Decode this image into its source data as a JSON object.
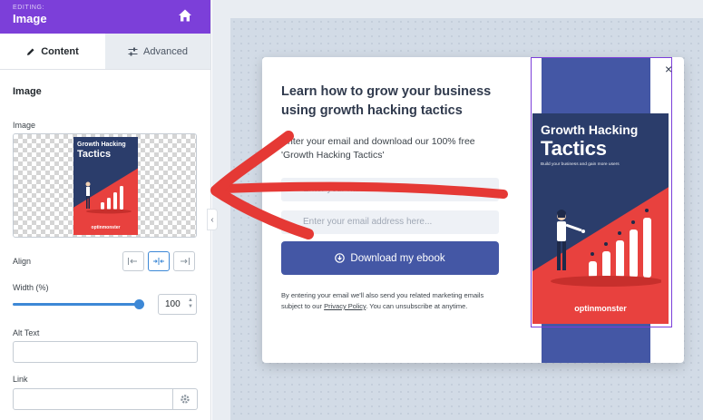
{
  "sidebar": {
    "editing_label": "EDITING:",
    "title": "Image",
    "tabs": [
      {
        "label": "Content",
        "active": true
      },
      {
        "label": "Advanced",
        "active": false
      }
    ],
    "section_title": "Image",
    "image_label": "Image",
    "preview": {
      "title_line1": "Growth Hacking",
      "title_line2": "Tactics",
      "brand": "optinmonster"
    },
    "align_label": "Align",
    "align_options": [
      "left",
      "center",
      "right"
    ],
    "align_selected": "center",
    "width_label": "Width (%)",
    "width_value": "100",
    "alt_text_label": "Alt Text",
    "alt_text_value": "",
    "link_label": "Link",
    "link_value": ""
  },
  "popup": {
    "headline": "Learn how to grow your business using growth hacking tactics",
    "description": "Enter your email and download our 100% free 'Growth Hacking Tactics'",
    "name_placeholder": "Enter your name here...",
    "email_placeholder": "Enter your email address here...",
    "cta_label": "Download my ebook",
    "fine_print_before": "By entering your email we'll also send you related marketing emails subject to our ",
    "fine_print_link": "Privacy Policy",
    "fine_print_after": ". You can unsubscribe at anytime.",
    "close_label": "×"
  },
  "book": {
    "title_line1": "Growth Hacking",
    "title_line2": "Tactics",
    "subtitle": "Build your business and gain more users",
    "brand": "optinmonster"
  },
  "colors": {
    "brand_purple": "#7c3fd9",
    "accent_blue": "#3d88d6",
    "cta_blue": "#4457a5",
    "book_navy": "#2b3d6b",
    "book_red": "#e8413e",
    "arrow_red": "#e53935"
  },
  "icons": [
    "home-icon",
    "pencil-icon",
    "sliders-icon",
    "align-left-icon",
    "align-center-icon",
    "align-right-icon",
    "gear-icon",
    "chevron-left-icon",
    "download-icon",
    "close-icon"
  ]
}
